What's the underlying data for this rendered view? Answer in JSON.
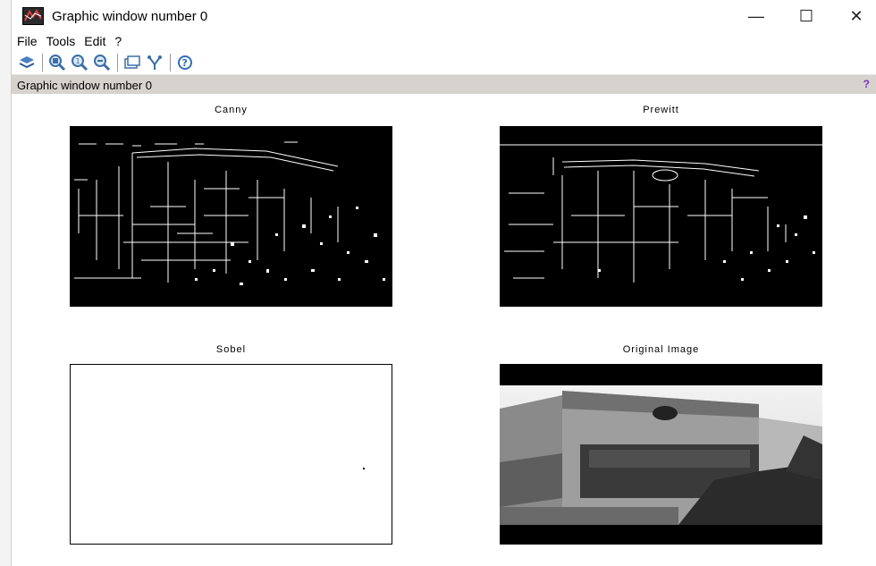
{
  "window": {
    "title": "Graphic window number 0",
    "controls": {
      "minimize": "—",
      "maximize": "☐",
      "close": "✕"
    }
  },
  "menu": [
    "File",
    "Tools",
    "Edit",
    "?"
  ],
  "toolbar": {
    "icons": [
      "rotate-icon",
      "zoom-icon",
      "zoom-reset-icon",
      "zoom-area-icon",
      "datatip-icon",
      "editor-icon",
      "help-icon"
    ]
  },
  "infobar": {
    "text": "Graphic window number 0",
    "help": "?"
  },
  "plots": {
    "canny": {
      "title": "Canny"
    },
    "prewitt": {
      "title": "Prewitt"
    },
    "sobel": {
      "title": "Sobel"
    },
    "original": {
      "title": "Original Image"
    }
  },
  "colors": {
    "infobar_bg": "#d6d3ce",
    "plot_bg": "#000000"
  }
}
